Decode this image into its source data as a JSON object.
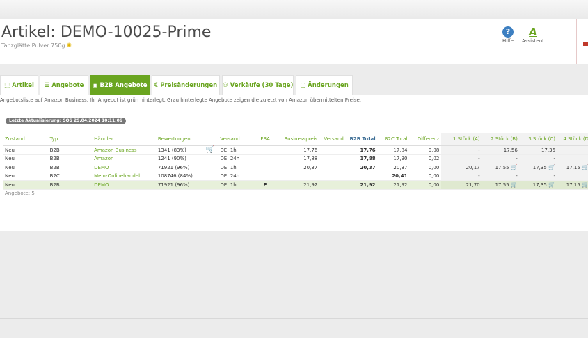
{
  "header": {
    "title": "Artikel: DEMO-10025-Prime",
    "subtitle": "Tanzglätte Pulver 750g",
    "help_label": "Hilfe",
    "assistant_label": "Assistent"
  },
  "tabs": [
    {
      "label": "Artikel",
      "icon": "box-icon"
    },
    {
      "label": "Angebote",
      "icon": "list-icon"
    },
    {
      "label": "B2B Angebote",
      "icon": "briefcase-icon"
    },
    {
      "label": "Preisänderungen",
      "icon": "euro-icon"
    },
    {
      "label": "Verkäufe (30 Tage)",
      "icon": "people-icon"
    },
    {
      "label": "Änderungen",
      "icon": "note-icon"
    }
  ],
  "content": {
    "description": "Angebotsliste auf Amazon Business. Ihr Angebot ist grün hinterlegt. Grau hinterlegte Angebote zeigen die zuletzt von Amazon übermittelten Preise.",
    "updated_badge": "Letzte Aktualisierung: SQS 29.04.2024 10:11:06"
  },
  "table": {
    "headers": [
      "Zustand",
      "Typ",
      "Händler",
      "Bewertungen",
      "",
      "Versand",
      "FBA",
      "Businesspreis",
      "Versand",
      "B2B Total",
      "B2C Total",
      "Differenz",
      "1 Stück (A)",
      "2 Stück (B)",
      "3 Stück (C)",
      "4 Stück (D"
    ],
    "rows": [
      {
        "zustand": "Neu",
        "typ": "B2B",
        "haendler": "Amazon Business",
        "bewertungen": "1341 (83%)",
        "cart": true,
        "versand": "DE: 1h",
        "fba": "",
        "businesspreis": "17,76",
        "versand2": "",
        "b2b_total": "17,76",
        "b2c_total": "17,84",
        "differenz": "0,08",
        "s1": "-",
        "s2": "17,56",
        "s3": "17,36",
        "s4": ""
      },
      {
        "zustand": "Neu",
        "typ": "B2B",
        "haendler": "Amazon",
        "bewertungen": "1241 (90%)",
        "cart": false,
        "versand": "DE: 24h",
        "fba": "",
        "businesspreis": "17,88",
        "versand2": "",
        "b2b_total": "17,88",
        "b2c_total": "17,90",
        "differenz": "0,02",
        "s1": "-",
        "s2": "-",
        "s3": "-",
        "s4": ""
      },
      {
        "zustand": "Neu",
        "typ": "B2B",
        "haendler": "DEMO",
        "bewertungen": "71921 (96%)",
        "cart": false,
        "versand": "DE: 1h",
        "fba": "",
        "businesspreis": "20,37",
        "versand2": "",
        "b2b_total": "20,37",
        "b2c_total": "20,37",
        "differenz": "0,00",
        "s1": "20,17",
        "s2": "17,55",
        "s3": "17,35",
        "s4": "17,15"
      },
      {
        "zustand": "Neu",
        "typ": "B2C",
        "haendler": "Mein-Onlinehandel",
        "bewertungen": "108746 (84%)",
        "cart": false,
        "versand": "DE: 24h",
        "fba": "",
        "businesspreis": "",
        "versand2": "",
        "b2b_total": "",
        "b2c_total": "20,41",
        "differenz": "0,00",
        "s1": "-",
        "s2": "-",
        "s3": "-",
        "s4": ""
      },
      {
        "zustand": "Neu",
        "typ": "B2B",
        "haendler": "DEMO",
        "bewertungen": "71921 (96%)",
        "cart": false,
        "versand": "DE: 1h",
        "fba": "P",
        "businesspreis": "21,92",
        "versand2": "",
        "b2b_total": "21,92",
        "b2c_total": "21,92",
        "differenz": "0,00",
        "s1": "21,70",
        "s2": "17,55",
        "s3": "17,35",
        "s4": "17,15"
      }
    ],
    "footer": "Angebote: 5"
  }
}
